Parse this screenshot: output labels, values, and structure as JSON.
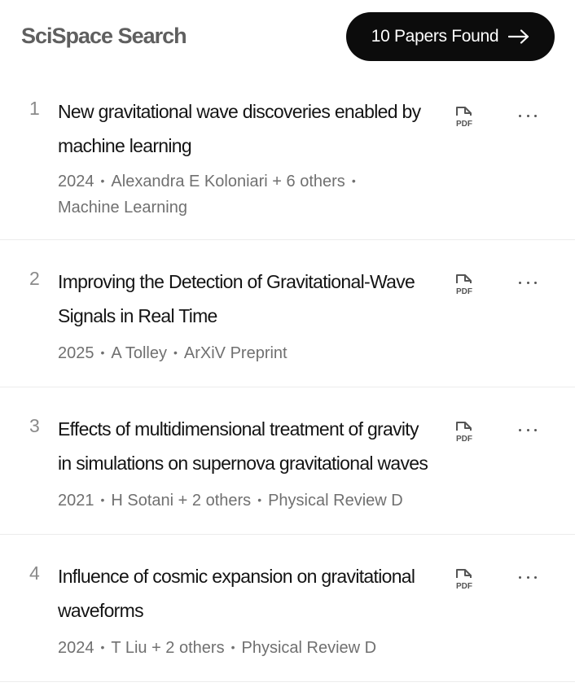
{
  "header": {
    "brand": "SciSpace Search",
    "papers_found_label": "10 Papers Found"
  },
  "results": [
    {
      "rank": "1",
      "title": "New gravitational wave discoveries enabled by machine learning",
      "year": "2024",
      "authors": "Alexandra E Koloniari + 6 others",
      "venue": "Machine Learning"
    },
    {
      "rank": "2",
      "title": "Improving the Detection of Gravitational-Wave Signals in Real Time",
      "year": "2025",
      "authors": "A Tolley",
      "venue": "ArXiV Preprint"
    },
    {
      "rank": "3",
      "title": "Effects of multidimensional treatment of gravity in simulations on supernova gravitational waves",
      "year": "2021",
      "authors": "H Sotani + 2 others",
      "venue": "Physical Review D"
    },
    {
      "rank": "4",
      "title": "Influence of cosmic expansion on gravitational waveforms",
      "year": "2024",
      "authors": "T Liu + 2 others",
      "venue": "Physical Review D"
    }
  ],
  "icons": {
    "pdf": "pdf-file-icon",
    "more": "more-options-icon",
    "arrow": "arrow-right-icon"
  },
  "colors": {
    "button_bg": "#0c0c0c",
    "brand_text": "#5f5f5f",
    "meta_text": "#707070"
  }
}
